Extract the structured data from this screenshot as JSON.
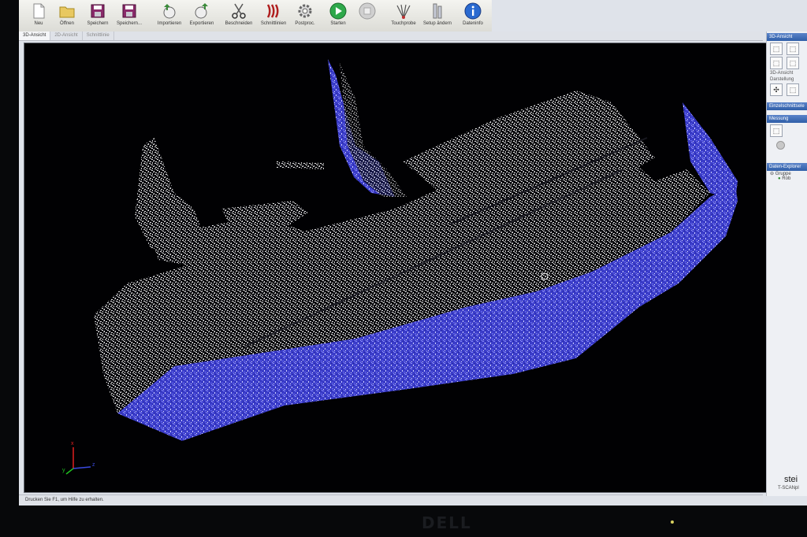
{
  "toolbar": {
    "buttons": [
      {
        "label": "Neu",
        "icon": "new-file-icon"
      },
      {
        "label": "Öffnen",
        "icon": "open-folder-icon"
      },
      {
        "label": "Speichern",
        "icon": "save-icon"
      },
      {
        "label": "Speichern...",
        "icon": "save-as-icon"
      },
      {
        "label": "Importieren",
        "icon": "import-icon"
      },
      {
        "label": "Exportieren",
        "icon": "export-icon"
      },
      {
        "label": "Beschneiden",
        "icon": "scissors-icon"
      },
      {
        "label": "Schnittlinien",
        "icon": "cut-lines-icon"
      },
      {
        "label": "Postproc.",
        "icon": "gear-icon"
      },
      {
        "label": "Starten",
        "icon": "play-icon"
      },
      {
        "label": "",
        "icon": "stop-icon"
      },
      {
        "label": "Touchprobe",
        "icon": "touchprobe-icon"
      },
      {
        "label": "Setup ändern",
        "icon": "setup-icon"
      },
      {
        "label": "Dateninfo",
        "icon": "info-icon"
      }
    ]
  },
  "tabs": [
    "3D-Ansicht",
    "2D-Ansicht",
    "Schnittlinie"
  ],
  "right_panel": {
    "view_header": "3D-Ansicht",
    "view_label": "3D-Ansicht",
    "display_label": "Darstellung",
    "cut_header": "Einzelschnittsele",
    "measure_header": "Messung",
    "explorer_header": "Daten-Explorer",
    "tree_group": "Gruppe",
    "tree_item": "Rob",
    "logo": "stei",
    "product": "T-SCANpl"
  },
  "axes": {
    "x": "x",
    "y": "y",
    "z": "z"
  },
  "status_text": "Drucken Sie F1, um Hilfe zu erhalten.",
  "monitor_brand": "DELL",
  "colors": {
    "point_white": "#e8e8e8",
    "point_blue": "#4a4ce0",
    "background": "#010103"
  }
}
